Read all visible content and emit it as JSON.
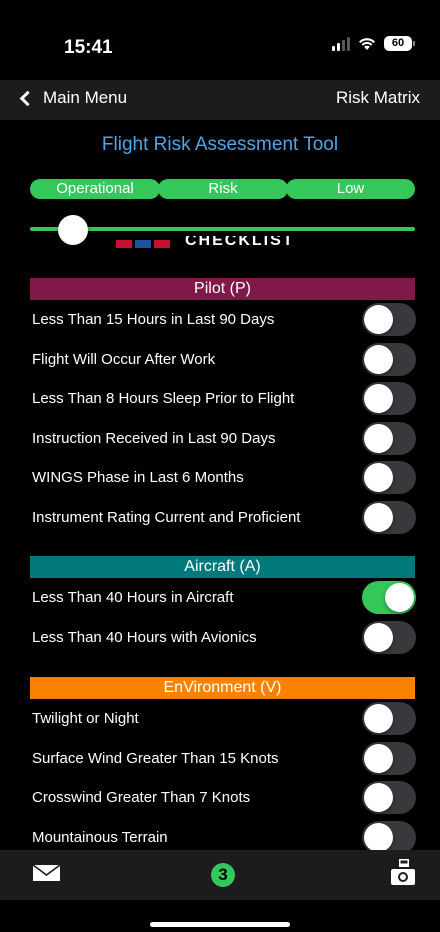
{
  "status": {
    "time": "15:41",
    "battery": "60"
  },
  "nav": {
    "back_label": "Main Menu",
    "right_label": "Risk Matrix"
  },
  "title": "Flight Risk Assessment Tool",
  "risk": {
    "labels": [
      "Operational",
      "Risk",
      "Low"
    ],
    "level": 0.08
  },
  "checklist_text": "CHECKLIST",
  "sections": [
    {
      "title": "Pilot (P)",
      "color": "#7f1a48",
      "items": [
        {
          "label": "Less Than 15 Hours in Last 90 Days",
          "on": false
        },
        {
          "label": "Flight Will Occur After Work",
          "on": false
        },
        {
          "label": "Less Than 8 Hours Sleep Prior to Flight",
          "on": false
        },
        {
          "label": "Instruction Received in Last 90 Days",
          "on": false
        },
        {
          "label": "WINGS Phase in Last 6 Months",
          "on": false
        },
        {
          "label": "Instrument Rating Current and Proficient",
          "on": false
        }
      ]
    },
    {
      "title": "Aircraft (A)",
      "color": "#00787c",
      "items": [
        {
          "label": "Less Than 40 Hours in Aircraft",
          "on": true
        },
        {
          "label": "Less Than 40 Hours with Avionics",
          "on": false
        }
      ]
    },
    {
      "title": "EnVironment (V)",
      "color": "#fb8200",
      "items": [
        {
          "label": "Twilight or Night",
          "on": false
        },
        {
          "label": "Surface Wind Greater Than 15 Knots",
          "on": false
        },
        {
          "label": "Crosswind Greater Than 7 Knots",
          "on": false
        },
        {
          "label": "Mountainous Terrain",
          "on": false
        }
      ]
    }
  ],
  "toolbar": {
    "count": "3"
  },
  "colors": {
    "accent_green": "#34c759",
    "title_blue": "#4ea5e8"
  },
  "icons": {
    "back": "chevron-left-icon",
    "mail": "mail-icon",
    "camera": "camera-icon"
  }
}
